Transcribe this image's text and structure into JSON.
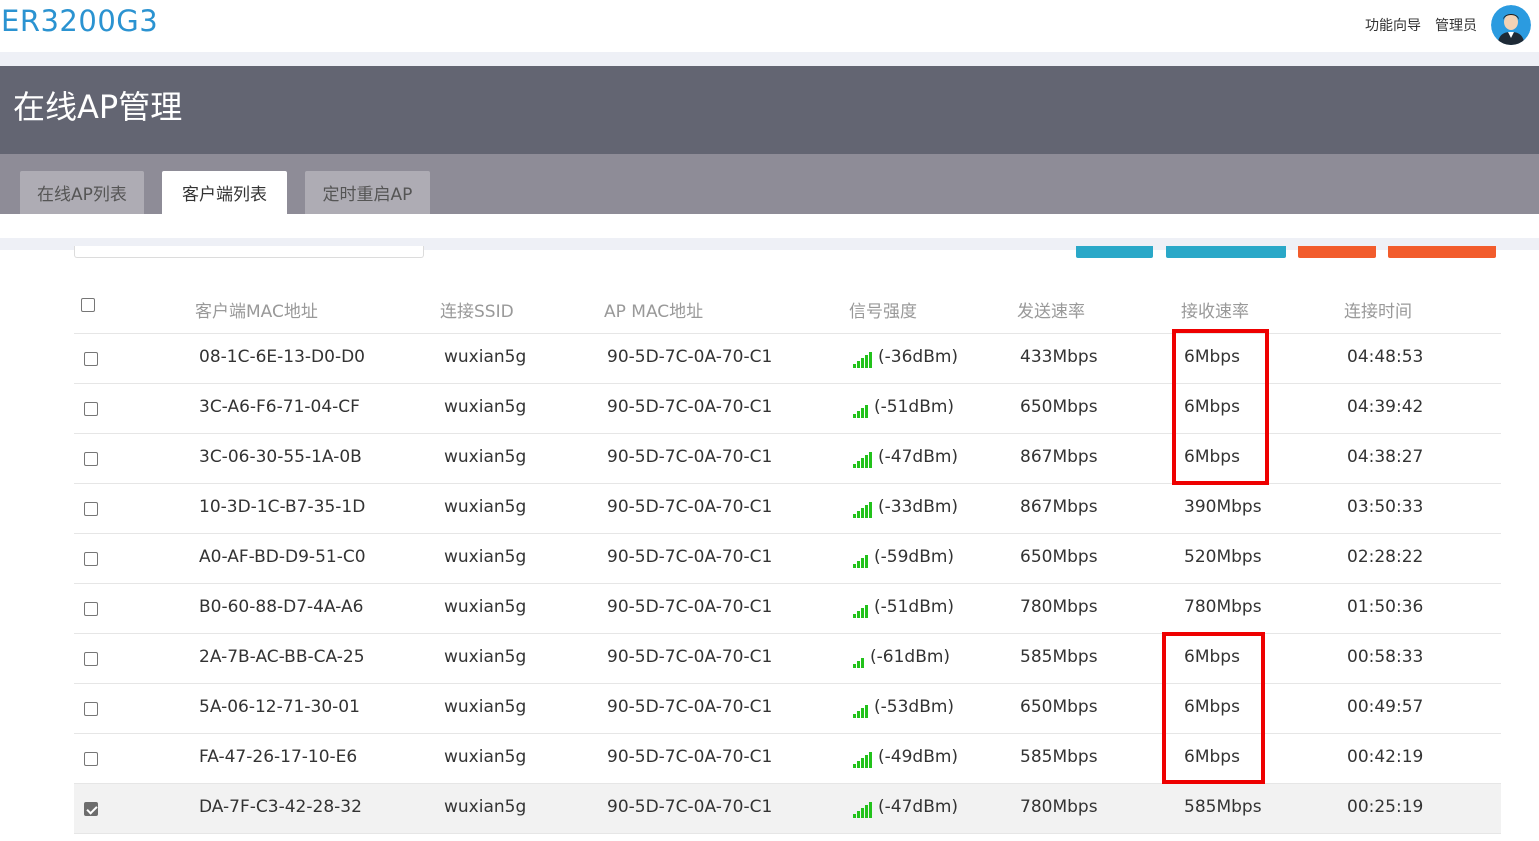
{
  "app": {
    "brand": "ER3200G3",
    "wizard_link": "功能向导",
    "admin_link": "管理员"
  },
  "page": {
    "title": "在线AP管理"
  },
  "tabs": [
    {
      "label": "在线AP列表",
      "active": false
    },
    {
      "label": "客户端列表",
      "active": true
    },
    {
      "label": "定时重启AP",
      "active": false
    }
  ],
  "colors": {
    "brand": "#2b93d1",
    "header_bg": "#636572",
    "tabbar_bg": "#8e8c97",
    "signal": "#22c21b",
    "highlight": "#ee0000",
    "btn_teal": "#2aa8c8",
    "btn_red": "#f25c2c"
  },
  "table": {
    "columns": [
      "客户端MAC地址",
      "连接SSID",
      "AP MAC地址",
      "信号强度",
      "发送速率",
      "接收速率",
      "连接时间"
    ],
    "rows": [
      {
        "mac": "08-1C-6E-13-D0-D0",
        "ssid": "wuxian5g",
        "ap_mac": "90-5D-7C-0A-70-C1",
        "signal_bars": 5,
        "signal": "(-36dBm)",
        "tx": "433Mbps",
        "rx": "6Mbps",
        "time": "04:48:53",
        "checked": false
      },
      {
        "mac": "3C-A6-F6-71-04-CF",
        "ssid": "wuxian5g",
        "ap_mac": "90-5D-7C-0A-70-C1",
        "signal_bars": 4,
        "signal": "(-51dBm)",
        "tx": "650Mbps",
        "rx": "6Mbps",
        "time": "04:39:42",
        "checked": false
      },
      {
        "mac": "3C-06-30-55-1A-0B",
        "ssid": "wuxian5g",
        "ap_mac": "90-5D-7C-0A-70-C1",
        "signal_bars": 5,
        "signal": "(-47dBm)",
        "tx": "867Mbps",
        "rx": "6Mbps",
        "time": "04:38:27",
        "checked": false
      },
      {
        "mac": "10-3D-1C-B7-35-1D",
        "ssid": "wuxian5g",
        "ap_mac": "90-5D-7C-0A-70-C1",
        "signal_bars": 5,
        "signal": "(-33dBm)",
        "tx": "867Mbps",
        "rx": "390Mbps",
        "time": "03:50:33",
        "checked": false
      },
      {
        "mac": "A0-AF-BD-D9-51-C0",
        "ssid": "wuxian5g",
        "ap_mac": "90-5D-7C-0A-70-C1",
        "signal_bars": 4,
        "signal": "(-59dBm)",
        "tx": "650Mbps",
        "rx": "520Mbps",
        "time": "02:28:22",
        "checked": false
      },
      {
        "mac": "B0-60-88-D7-4A-A6",
        "ssid": "wuxian5g",
        "ap_mac": "90-5D-7C-0A-70-C1",
        "signal_bars": 4,
        "signal": "(-51dBm)",
        "tx": "780Mbps",
        "rx": "780Mbps",
        "time": "01:50:36",
        "checked": false
      },
      {
        "mac": "2A-7B-AC-BB-CA-25",
        "ssid": "wuxian5g",
        "ap_mac": "90-5D-7C-0A-70-C1",
        "signal_bars": 3,
        "signal": "(-61dBm)",
        "tx": "585Mbps",
        "rx": "6Mbps",
        "time": "00:58:33",
        "checked": false
      },
      {
        "mac": "5A-06-12-71-30-01",
        "ssid": "wuxian5g",
        "ap_mac": "90-5D-7C-0A-70-C1",
        "signal_bars": 4,
        "signal": "(-53dBm)",
        "tx": "650Mbps",
        "rx": "6Mbps",
        "time": "00:49:57",
        "checked": false
      },
      {
        "mac": "FA-47-26-17-10-E6",
        "ssid": "wuxian5g",
        "ap_mac": "90-5D-7C-0A-70-C1",
        "signal_bars": 5,
        "signal": "(-49dBm)",
        "tx": "585Mbps",
        "rx": "6Mbps",
        "time": "00:42:19",
        "checked": false
      },
      {
        "mac": "DA-7F-C3-42-28-32",
        "ssid": "wuxian5g",
        "ap_mac": "90-5D-7C-0A-70-C1",
        "signal_bars": 5,
        "signal": "(-47dBm)",
        "tx": "780Mbps",
        "rx": "585Mbps",
        "time": "00:25:19",
        "checked": true
      }
    ]
  }
}
